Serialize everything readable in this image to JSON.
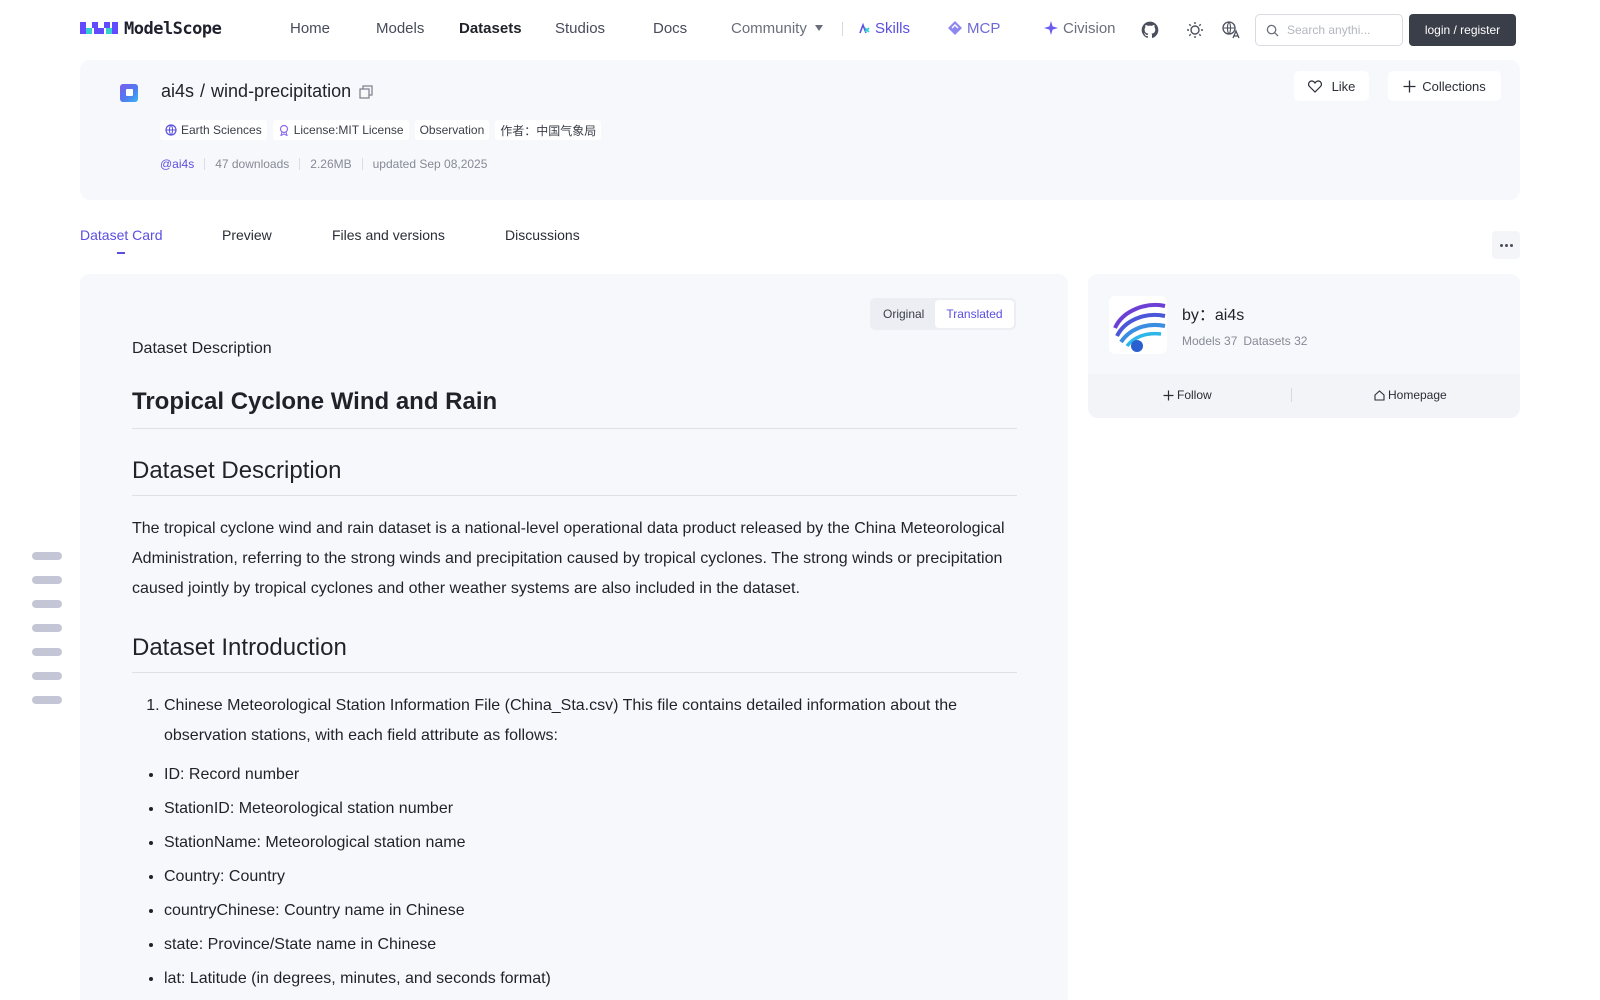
{
  "brand": {
    "name": "ModelScope"
  },
  "nav": {
    "home": "Home",
    "models": "Models",
    "datasets": "Datasets",
    "studios": "Studios",
    "docs": "Docs",
    "community": "Community",
    "skills": "Skills",
    "mcp": "MCP",
    "civision": "Civision"
  },
  "search": {
    "placeholder": "Search anythi..."
  },
  "auth": {
    "login_label": "login / register"
  },
  "dataset": {
    "owner": "ai4s",
    "separator": "/",
    "name": "wind-precipitation",
    "tags": [
      "Earth Sciences",
      "License:MIT License",
      "Observation",
      "作者：中国气象局"
    ],
    "author_handle": "@ai4s",
    "downloads": "47 downloads",
    "size": "2.26MB",
    "updated": "updated Sep 08,2025",
    "like_label": "Like",
    "collections_label": "Collections"
  },
  "tabs": [
    "Dataset Card",
    "Preview",
    "Files and versions",
    "Discussions"
  ],
  "lang_toggle": {
    "original": "Original",
    "translated": "Translated"
  },
  "content": {
    "pre_title": "Dataset Description",
    "h1": "Tropical Cyclone Wind and Rain",
    "section1_title": "Dataset Description",
    "section1_body": "The tropical cyclone wind and rain dataset is a national-level operational data product released by the China Meteorological Administration, referring to the strong winds and precipitation caused by tropical cyclones. The strong winds or precipitation caused jointly by tropical cyclones and other weather systems are also included in the dataset.",
    "section2_title": "Dataset Introduction",
    "ordered_item_1": "Chinese Meteorological Station Information File (China_Sta.csv) This file contains detailed information about the observation stations, with each field attribute as follows:",
    "fields": [
      "ID: Record number",
      "StationID: Meteorological station number",
      "StationName: Meteorological station name",
      "Country: Country",
      "countryChinese: Country name in Chinese",
      "state: Province/State name in Chinese",
      "lat: Latitude (in degrees, minutes, and seconds format)"
    ]
  },
  "author_card": {
    "name": "by：ai4s",
    "models": "Models 37",
    "datasets": "Datasets 32",
    "follow_label": "Follow",
    "homepage_label": "Homepage"
  },
  "colors": {
    "accent": "#5b4fe0",
    "dark_button": "#3a3e48",
    "card_bg": "#f7f8fb"
  }
}
